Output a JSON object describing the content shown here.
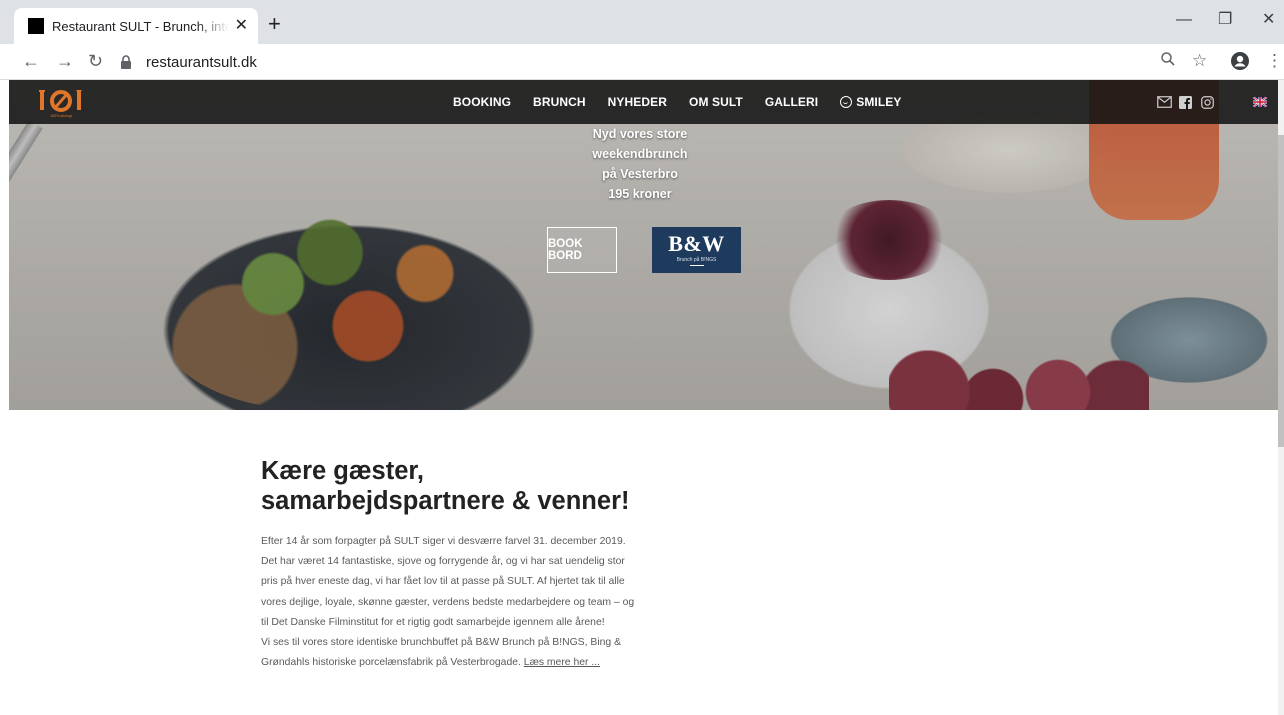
{
  "browser": {
    "tab": {
      "title": "Restaurant SULT - Brunch, internationale"
    },
    "newtab_glyph": "+",
    "url": "restaurantsult.dk"
  },
  "site": {
    "logo_tagline": "100% økologi",
    "nav": [
      {
        "label": "BOOKING"
      },
      {
        "label": "BRUNCH"
      },
      {
        "label": "NYHEDER"
      },
      {
        "label": "OM SULT"
      },
      {
        "label": "GALLERI"
      },
      {
        "label": "SMILEY",
        "icon": "smiley-icon"
      }
    ],
    "social_icons": [
      "mail-icon",
      "facebook-icon",
      "instagram-icon"
    ],
    "language_flag": "uk-flag-icon"
  },
  "hero": {
    "lines": [
      "Nyd vores store",
      "weekendbrunch",
      "på Vesterbro",
      "195 kroner"
    ],
    "book_button": "BOOK BORD",
    "bw_logo": "B&W",
    "bw_sub": "Brunch på B!NGS"
  },
  "content": {
    "heading_line1": "Kære gæster,",
    "heading_line2": "samarbejdspartnere & venner!",
    "paragraph1": "Efter 14 år som forpagter på SULT siger vi desværre farvel 31. december 2019. Det har været 14 fantastiske, sjove og forrygende år, og vi har sat uendelig stor pris på hver eneste dag, vi har fået lov til at passe på SULT. Af hjertet tak til alle vores dejlige, loyale, skønne gæster, verdens bedste medarbejdere og team – og til Det Danske Filminstitut for et rigtig godt samarbejde igennem alle årene!",
    "paragraph2": "Vi ses til vores store identiske brunchbuffet på B&W Brunch på B!NGS, Bing & Grøndahls historiske porcelænsfabrik på Vesterbrogade.",
    "read_more": "Læs mere her ..."
  },
  "colors": {
    "nav_bg": "#141414",
    "logo_orange": "#e0762a",
    "bw_blue": "#1e3a5c",
    "heading": "#222222",
    "body_text": "#5a5a5a"
  }
}
